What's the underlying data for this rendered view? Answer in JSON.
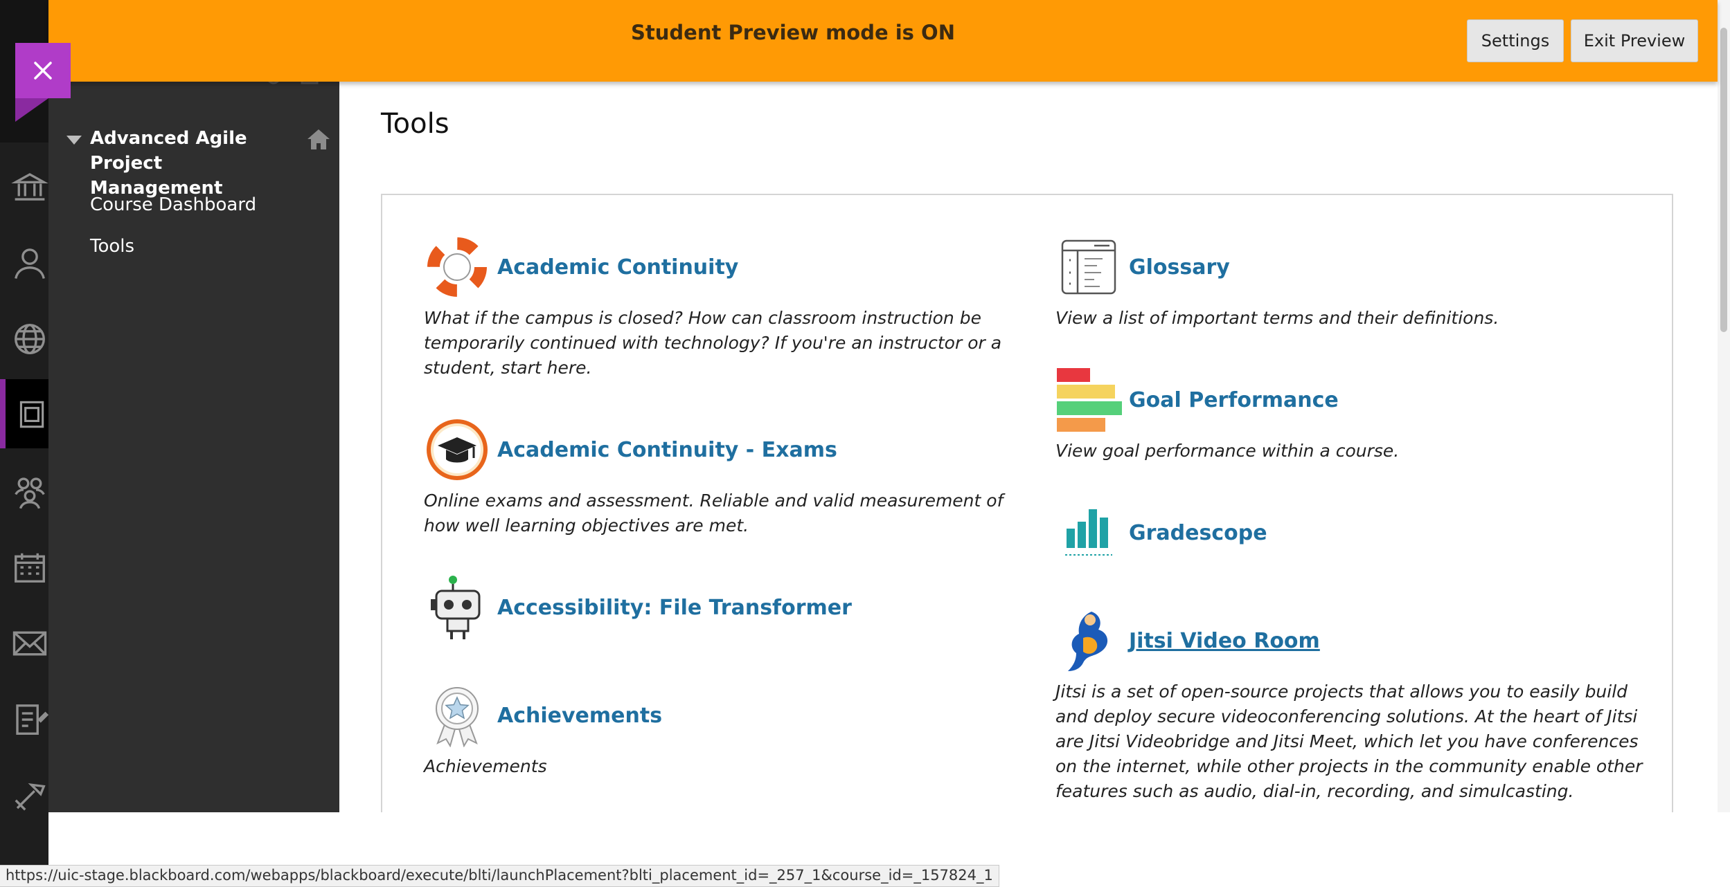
{
  "banner": {
    "text": "Student Preview mode is ON",
    "settings_label": "Settings",
    "exit_label": "Exit Preview",
    "color": "#ff9a05"
  },
  "close_button": {
    "icon": "close-icon",
    "color": "#b03cc8"
  },
  "rail": {
    "icons": [
      "institution-icon",
      "user-icon",
      "globe-icon",
      "courses-icon",
      "groups-icon",
      "calendar-icon",
      "mail-icon",
      "grades-icon",
      "tools-icon"
    ],
    "active": "courses-icon"
  },
  "course_menu": {
    "title": "Advanced Agile Project Management",
    "items": [
      "Course Dashboard",
      "Tools"
    ]
  },
  "main": {
    "page_title": "Tools",
    "tools_left": [
      {
        "name": "Academic Continuity",
        "icon": "life-ring-icon",
        "description": "What if the campus is closed? How can classroom instruction be temporarily continued with technology? If you're an instructor or a student, start here."
      },
      {
        "name": "Academic Continuity - Exams",
        "icon": "graduation-cap-icon",
        "description": "Online exams and assessment.  Reliable and valid measurement of how well learning objectives are met."
      },
      {
        "name": "Accessibility: File Transformer",
        "icon": "robot-icon",
        "description": ""
      },
      {
        "name": "Achievements",
        "icon": "award-ribbon-icon",
        "description": "Achievements"
      }
    ],
    "tools_right": [
      {
        "name": "Glossary",
        "icon": "glossary-icon",
        "description": "View a list of important terms and their definitions."
      },
      {
        "name": "Goal Performance",
        "icon": "goal-bars-icon",
        "description": "View goal performance within a course."
      },
      {
        "name": "Gradescope",
        "icon": "gradescope-icon",
        "description": ""
      },
      {
        "name": "Jitsi Video Room",
        "icon": "jitsi-icon",
        "description": "Jitsi is a set of open-source projects that allows you to easily build and deploy secure videoconferencing solutions. At the heart of Jitsi are Jitsi Videobridge and Jitsi Meet, which let you have conferences on the internet, while other projects in the community enable other features such as audio, dial-in, recording, and simulcasting."
      }
    ],
    "link_color": "#1f6fa0"
  },
  "status_bar": {
    "url": "https://uic-stage.blackboard.com/webapps/blackboard/execute/blti/launchPlacement?blti_placement_id=_257_1&course_id=_157824_1"
  }
}
